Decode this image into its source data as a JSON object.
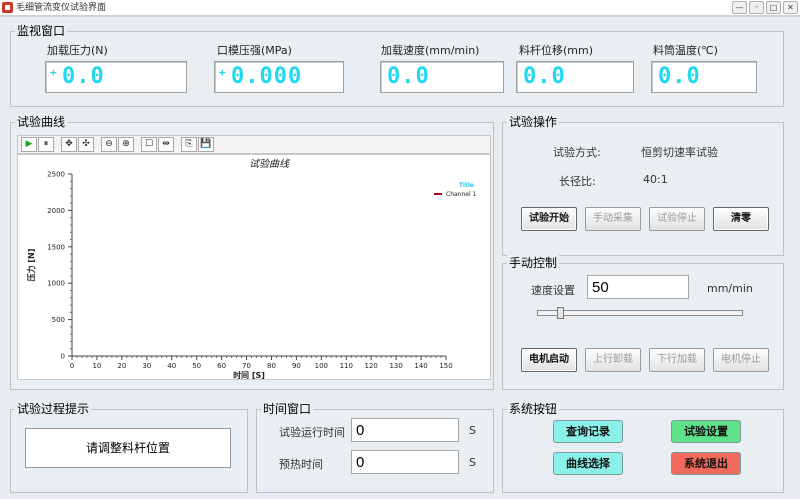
{
  "window": {
    "title": "毛细管流变仪试验界面",
    "buttons": [
      "—",
      "◦",
      "□",
      "✕"
    ]
  },
  "monitor": {
    "title": "监视窗口",
    "items": [
      {
        "label": "加载压力(N)",
        "sign": "+",
        "value": "0.0"
      },
      {
        "label": "口模压强(MPa)",
        "sign": "+",
        "value": "0.000"
      },
      {
        "label": "加载速度(mm/min)",
        "sign": "",
        "value": "0.0"
      },
      {
        "label": "料杆位移(mm)",
        "sign": "",
        "value": "0.0"
      },
      {
        "label": "料筒温度(℃)",
        "sign": "",
        "value": "0.0"
      }
    ]
  },
  "curve": {
    "title": "试验曲线",
    "toolbar": [
      "▶",
      "⏸",
      "✥",
      "✣",
      "⊖",
      "⊕",
      "☐",
      "⇹",
      "⎘",
      "💾"
    ]
  },
  "chart_data": {
    "type": "line",
    "title": "试验曲线",
    "xlabel": "时间 [S]",
    "ylabel": "压力 [N]",
    "xlim": [
      0,
      150
    ],
    "ylim": [
      0,
      2500
    ],
    "x_ticks": [
      0,
      10,
      20,
      30,
      40,
      50,
      60,
      70,
      80,
      90,
      100,
      110,
      120,
      130,
      140,
      150
    ],
    "y_ticks": [
      0,
      500,
      1000,
      1500,
      2000,
      2500
    ],
    "legend_title": "Title",
    "legend_placement": "top-right",
    "grid": false,
    "series": [
      {
        "name": "Channel 1",
        "color": "#c0001a",
        "x": [],
        "y": []
      }
    ]
  },
  "operation": {
    "title": "试验操作",
    "mode_label": "试验方式:",
    "mode_value": "恒剪切速率试验",
    "ratio_label": "长径比:",
    "ratio_value": "40:1",
    "buttons": [
      "试验开始",
      "手动采集",
      "试验停止",
      "清零"
    ]
  },
  "manual": {
    "title": "手动控制",
    "speed_label": "速度设置",
    "speed_value": "50",
    "speed_unit": "mm/min",
    "slider_value": 0.1,
    "buttons": [
      "电机启动",
      "上行卸载",
      "下行加载",
      "电机停止"
    ]
  },
  "hint": {
    "title": "试验过程提示",
    "text": "请调整料杆位置"
  },
  "time": {
    "title": "时间窗口",
    "run_label": "试验运行时间",
    "run_value": "0",
    "run_unit": "S",
    "preheat_label": "预热时间",
    "preheat_value": "0",
    "preheat_unit": "S"
  },
  "system": {
    "title": "系统按钮",
    "buttons": [
      {
        "label": "查询记录",
        "color": "#8af0e8"
      },
      {
        "label": "试验设置",
        "color": "#5fe08a"
      },
      {
        "label": "曲线选择",
        "color": "#8af0e8"
      },
      {
        "label": "系统退出",
        "color": "#f26a5e"
      }
    ]
  }
}
